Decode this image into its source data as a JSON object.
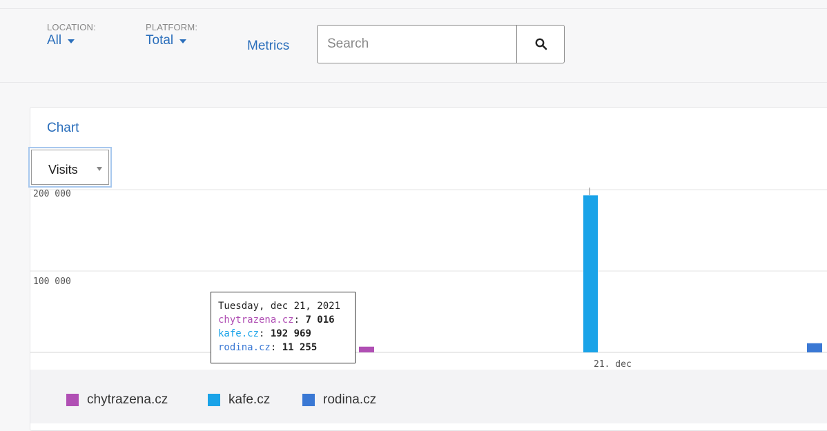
{
  "filters": {
    "location": {
      "label": "LOCATION:",
      "value": "All"
    },
    "platform": {
      "label": "PLATFORM:",
      "value": "Total"
    },
    "metrics_link": "Metrics"
  },
  "search": {
    "placeholder": "Search",
    "icon": "search-icon"
  },
  "chart_card": {
    "title": "Chart",
    "metric_select": "Visits"
  },
  "chart_data": {
    "type": "bar",
    "x_category": "21. dec",
    "x_tick_labels": [
      "21. dec"
    ],
    "y_ticks": [
      100000,
      200000
    ],
    "y_tick_labels": [
      "100 000",
      "200 000"
    ],
    "ylim": [
      0,
      210000
    ],
    "series": [
      {
        "name": "chytrazena.cz",
        "color": "#b04fb4",
        "value": 7016
      },
      {
        "name": "kafe.cz",
        "color": "#1aa3e8",
        "value": 192969
      },
      {
        "name": "rodina.cz",
        "color": "#3a78d4",
        "value": 11255
      }
    ],
    "grid": true,
    "legend_position": "bottom"
  },
  "tooltip": {
    "date": "Tuesday, dec 21, 2021",
    "rows": [
      {
        "name": "chytrazena.cz",
        "value": "7 016",
        "color": "#b04fb4"
      },
      {
        "name": "kafe.cz",
        "value": "192 969",
        "color": "#1aa3e8"
      },
      {
        "name": "rodina.cz",
        "value": "11 255",
        "color": "#3a78d4"
      }
    ]
  }
}
